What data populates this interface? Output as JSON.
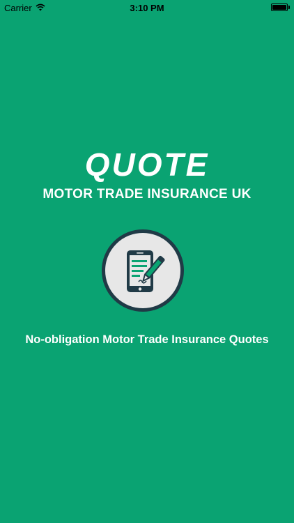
{
  "status_bar": {
    "carrier": "Carrier",
    "time": "3:10 PM",
    "battery_level": 1.0,
    "icons": [
      "wifi-icon",
      "battery-icon"
    ]
  },
  "main": {
    "title": "QUOTE",
    "subtitle": "MOTOR TRADE INSURANCE UK",
    "logo_icon": "phone-form-pen-icon",
    "tagline": "No-obligation Motor Trade Insurance Quotes"
  },
  "colors": {
    "background": "#0aa372",
    "icon_ring": "#203a46",
    "icon_fill": "#e7e7e7",
    "pen_accent": "#0aa372"
  }
}
